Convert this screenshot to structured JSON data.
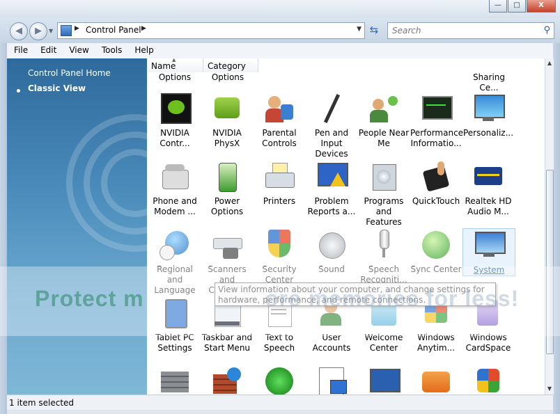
{
  "window": {
    "buttons": {
      "minimize": "—",
      "maximize": "□",
      "close": "X"
    }
  },
  "nav": {
    "back_glyph": "◀",
    "forward_glyph": "▶",
    "address": {
      "crumb": "Control Panel",
      "arrow": "▶",
      "dropdown": "▼"
    },
    "search_placeholder": "Search",
    "search_icon": "magnifier-icon",
    "refresh_icon": "refresh-icon"
  },
  "menu": [
    "File",
    "Edit",
    "View",
    "Tools",
    "Help"
  ],
  "left_pane": {
    "links": [
      {
        "label": "Control Panel Home"
      },
      {
        "label": "Classic View"
      }
    ]
  },
  "columns": [
    "Name",
    "Category"
  ],
  "top_partial_labels": [
    "Options",
    "Options",
    "Sharing Ce..."
  ],
  "items": [
    {
      "label": "NVIDIA\nContr...",
      "icon": "nvidia-control-icon"
    },
    {
      "label": "NVIDIA\nPhysX",
      "icon": "nvidia-physx-icon"
    },
    {
      "label": "Parental\nControls",
      "icon": "parental-controls-icon"
    },
    {
      "label": "Pen and\nInput Devices",
      "icon": "pen-icon"
    },
    {
      "label": "People Near\nMe",
      "icon": "people-near-me-icon"
    },
    {
      "label": "Performance\nInformatio...",
      "icon": "performance-icon"
    },
    {
      "label": "Personaliz...",
      "icon": "personalization-icon"
    },
    {
      "label": "Phone and\nModem ...",
      "icon": "phone-icon"
    },
    {
      "label": "Power\nOptions",
      "icon": "power-icon"
    },
    {
      "label": "Printers",
      "icon": "printer-icon"
    },
    {
      "label": "Problem\nReports a...",
      "icon": "problem-reports-icon"
    },
    {
      "label": "Programs\nand Features",
      "icon": "programs-icon"
    },
    {
      "label": "QuickTouch",
      "icon": "quicktouch-icon"
    },
    {
      "label": "Realtek HD\nAudio M...",
      "icon": "realtek-audio-icon"
    },
    {
      "label": "Regional and\nLanguage ...",
      "icon": "regional-icon"
    },
    {
      "label": "Scanners and\nCameras",
      "icon": "scanner-icon"
    },
    {
      "label": "Security\nCenter",
      "icon": "security-shield-icon"
    },
    {
      "label": "Sound",
      "icon": "sound-icon"
    },
    {
      "label": "Speech\nRecogniti...",
      "icon": "microphone-icon"
    },
    {
      "label": "Sync Center",
      "icon": "sync-icon"
    },
    {
      "label": "System",
      "icon": "system-monitor-icon"
    },
    {
      "label": "Tablet PC\nSettings",
      "icon": "tablet-icon"
    },
    {
      "label": "Taskbar and\nStart Menu",
      "icon": "taskbar-icon"
    },
    {
      "label": "Text to\nSpeech",
      "icon": "text-speech-icon"
    },
    {
      "label": "User\nAccounts",
      "icon": "user-accounts-icon"
    },
    {
      "label": "Welcome\nCenter",
      "icon": "welcome-center-icon"
    },
    {
      "label": "Windows\nAnytim...",
      "icon": "windows-anytime-icon"
    },
    {
      "label": "Windows\nCardSpace",
      "icon": "cardspace-icon"
    },
    {
      "label": "",
      "icon": "firewall-icon"
    },
    {
      "label": "",
      "icon": "firewall-globe-icon"
    },
    {
      "label": "",
      "icon": "radar-icon"
    },
    {
      "label": "",
      "icon": "checklist-icon"
    },
    {
      "label": "",
      "icon": "windows-update-icon"
    },
    {
      "label": "",
      "icon": "mobility-icon"
    },
    {
      "label": "",
      "icon": "windows-logo-icon"
    }
  ],
  "tooltip": "View information about your computer, and change settings for hardware, performance, and remote connections.",
  "watermark": {
    "left": "Protect m",
    "right": "ore memories for less!"
  },
  "status": "1 item selected",
  "colors": {
    "accent": "#2e6a9c",
    "selection": "#e8f3fd"
  }
}
